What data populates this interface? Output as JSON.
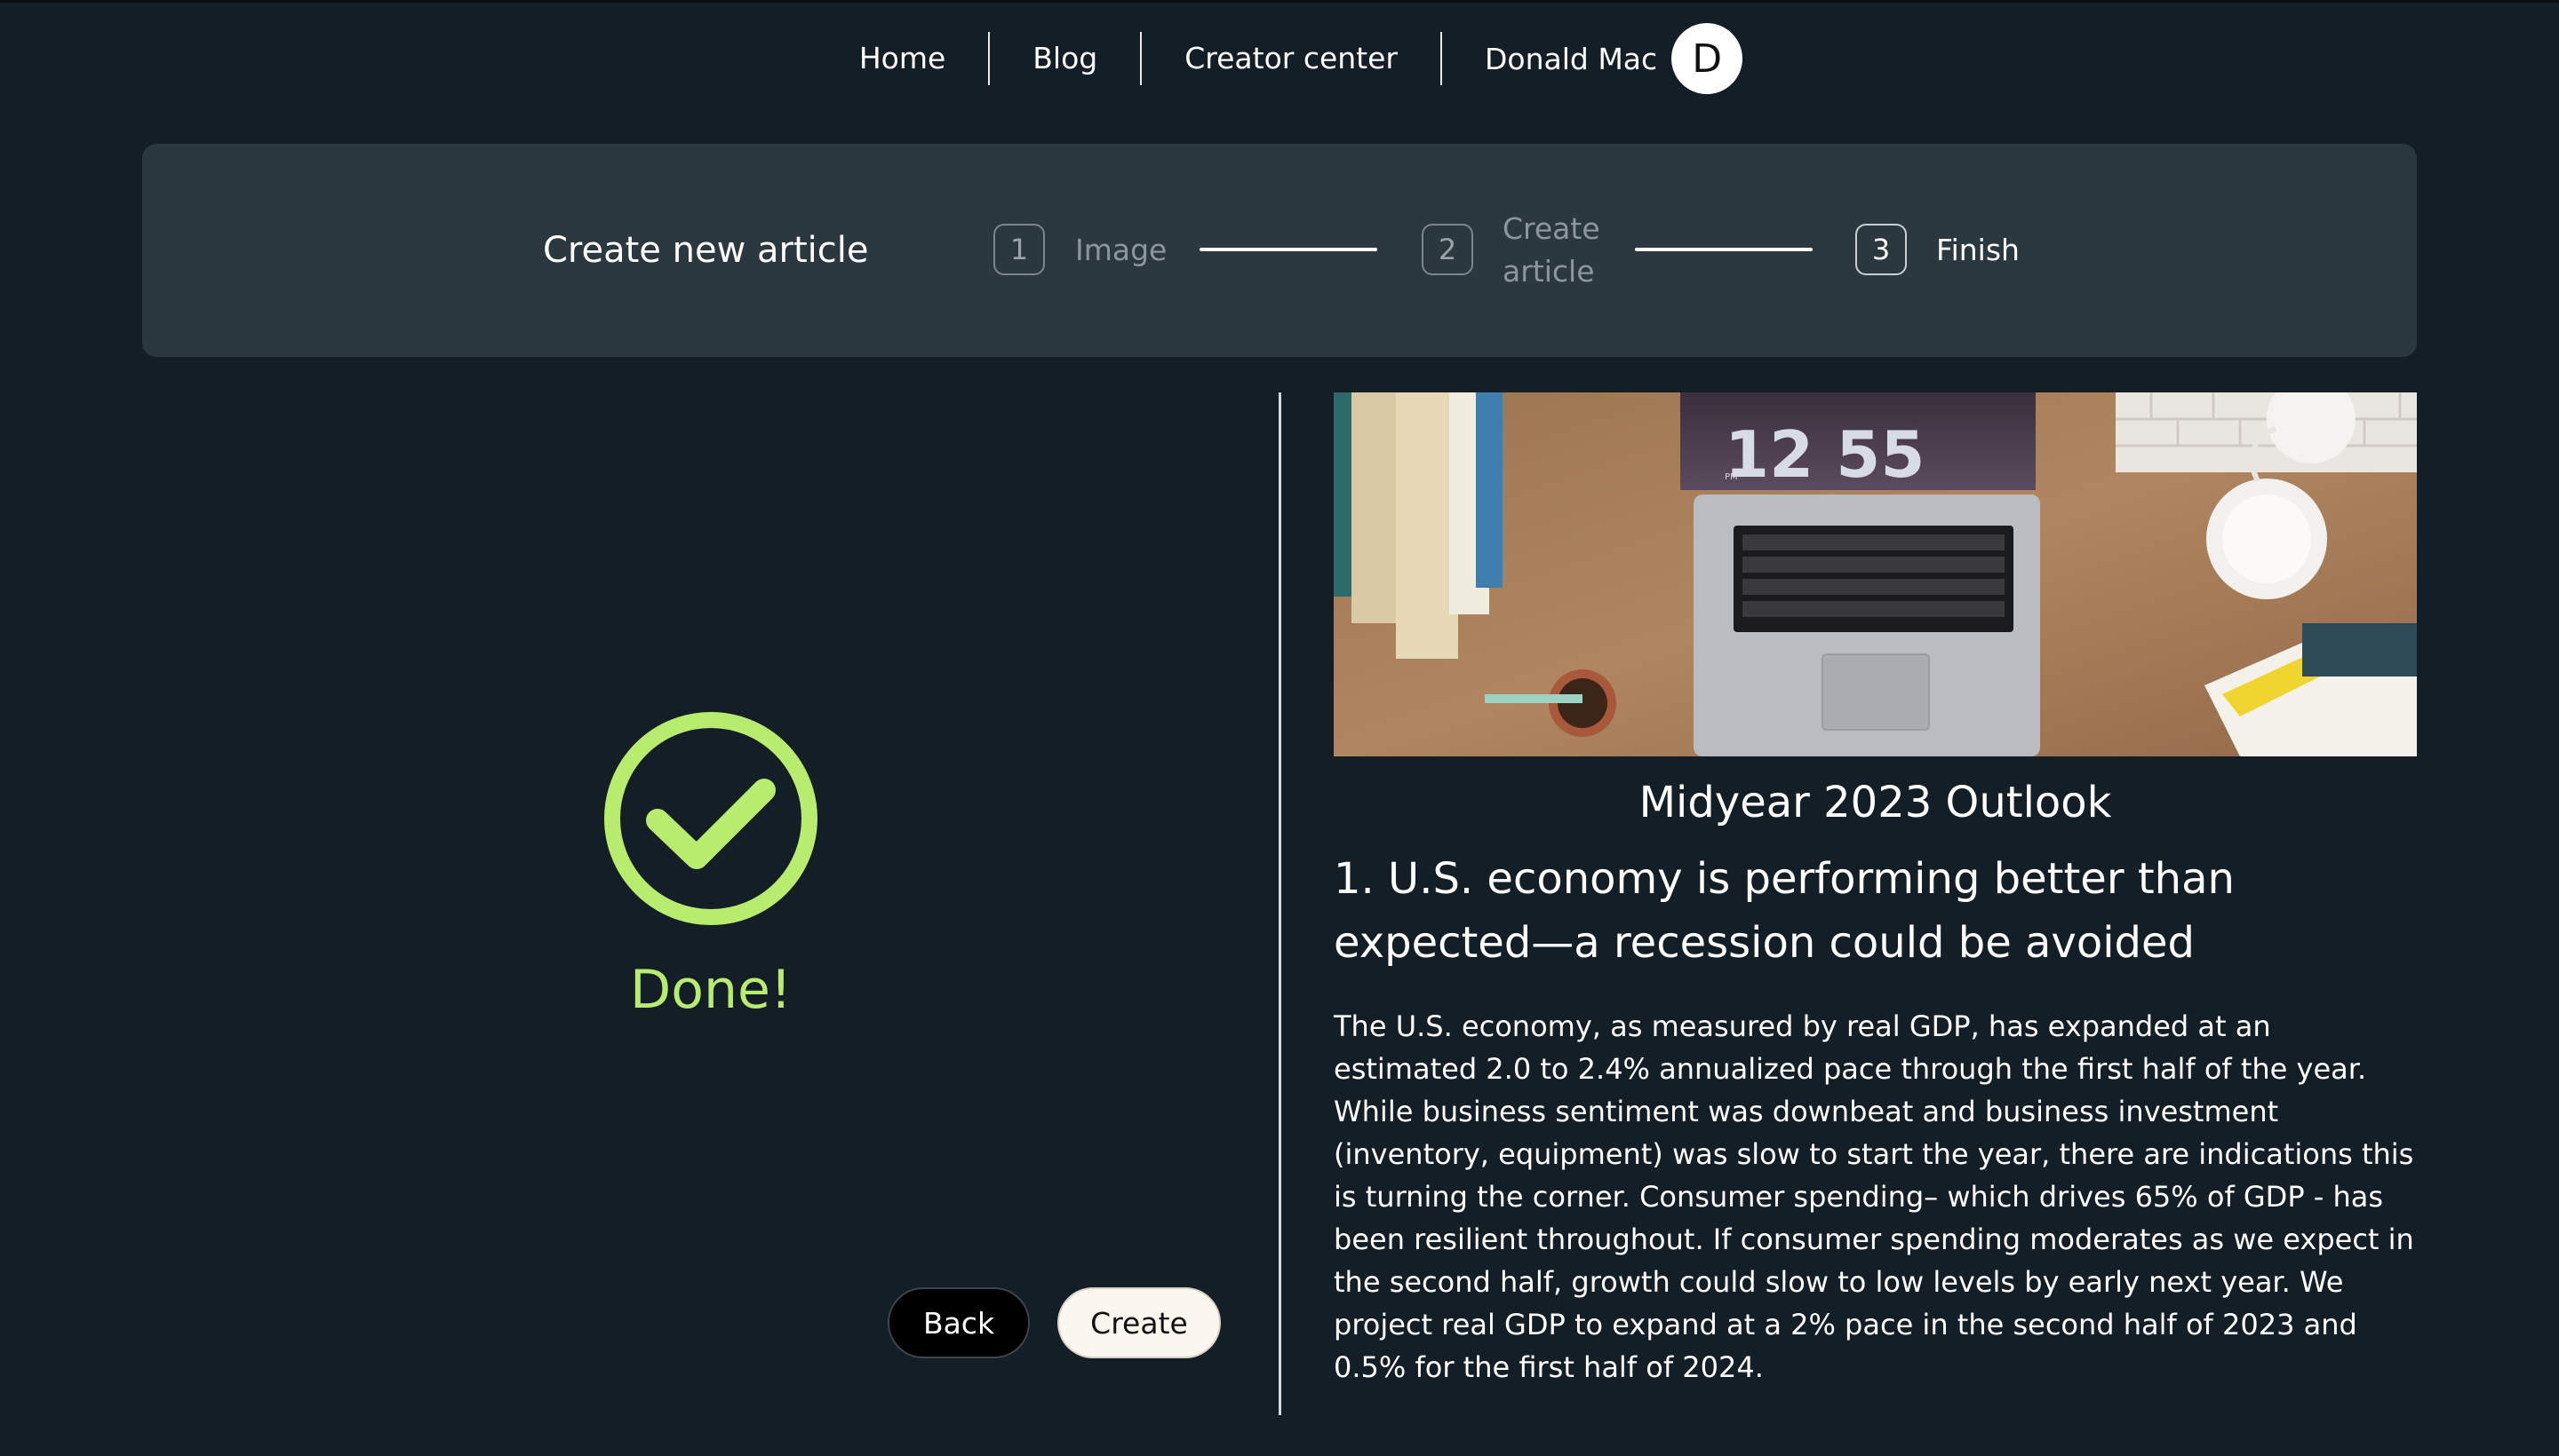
{
  "nav": {
    "links": [
      "Home",
      "Blog",
      "Creator center"
    ],
    "user_name": "Donald Mac",
    "avatar_initial": "D"
  },
  "stepper": {
    "title": "Create new article",
    "steps": [
      {
        "number": "1",
        "label": "Image",
        "active": false
      },
      {
        "number": "2",
        "label": "Create article",
        "label_lines": [
          "Create",
          "article"
        ],
        "active": false
      },
      {
        "number": "3",
        "label": "Finish",
        "active": true
      }
    ]
  },
  "status": {
    "done_text": "Done!",
    "icon": "check-circle-icon",
    "color": "#b7ec6f"
  },
  "buttons": {
    "back": "Back",
    "create": "Create"
  },
  "article": {
    "image_clock_text": "12 55",
    "image_clock_period": "PM",
    "title": "Midyear 2023 Outlook",
    "heading": "1. U.S. economy is performing better than expected—a recession could be avoided",
    "body": "The U.S. economy, as measured by real GDP, has expanded at an estimated 2.0 to 2.4% annualized pace through the first half of the year. While business sentiment was downbeat and business investment (inventory, equipment) was slow to start the year, there are indications this is turning the corner. Consumer spending– which drives 65% of GDP - has been resilient throughout. If consumer spending moderates as we expect in the second half, growth could slow to low levels by early next year. We project real GDP to expand at a 2% pace in the second half of 2023 and 0.5% for the first half of 2024."
  },
  "colors": {
    "background": "#141e26",
    "panel": "#2c383f",
    "accent": "#b7ec6f"
  }
}
